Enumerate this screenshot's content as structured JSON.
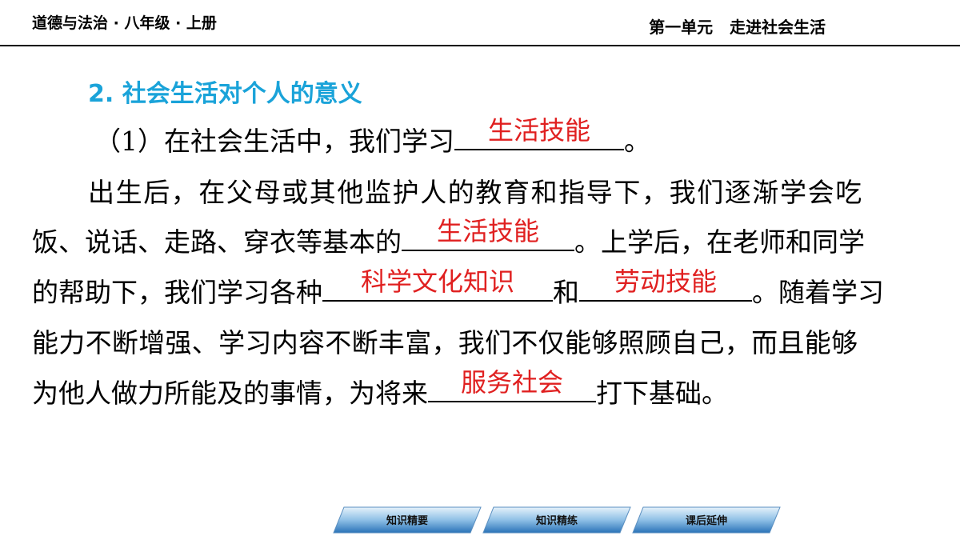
{
  "header": {
    "left": "道德与法治 · 八年级 · 上册",
    "right": "第一单元   走进社会生活"
  },
  "section_title": "2. 社会生活对个人的意义",
  "para1": {
    "prefix": "（1）在社会生活中，我们学习",
    "answer": "生活技能",
    "suffix": "。"
  },
  "para2": {
    "line1": "出生后，在父母或其他监护人的教育和指导下，我们逐渐学会吃",
    "line2_prefix": "饭、说话、走路、穿衣等基本的",
    "line2_answer": "生活技能",
    "line2_suffix": "。上学后，在老师和同学",
    "line3_prefix": "的帮助下，我们学习各种",
    "line3_answer1": "科学文化知识",
    "line3_mid": "和",
    "line3_answer2": "劳动技能",
    "line3_suffix": "。随着学习",
    "line4": "能力不断增强、学习内容不断丰富，我们不仅能够照顾自己，而且能够",
    "line5_prefix": "为他人做力所能及的事情，为将来",
    "line5_answer": "服务社会",
    "line5_suffix": "打下基础。"
  },
  "nav": {
    "btn1": "知识精要",
    "btn2": "知识精练",
    "btn3": "课后延伸"
  },
  "colors": {
    "title": "#1aa3d9",
    "answer": "#e02020",
    "nav_gradient_top": "#cfe6f7",
    "nav_gradient_bottom": "#2a73b8"
  }
}
